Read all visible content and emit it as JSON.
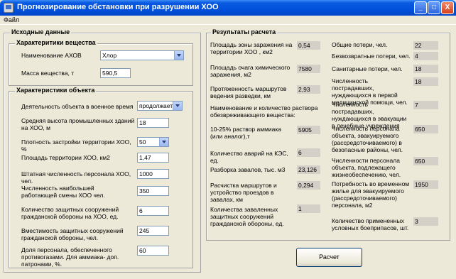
{
  "window": {
    "title": "Прогнозирование обстановки при разрушении ХОО",
    "minimize_glyph": "_",
    "maximize_glyph": "□",
    "close_glyph": "X"
  },
  "menu": {
    "file": "Файл"
  },
  "input_panel": {
    "title": "Исходные данные",
    "substance": {
      "title": "Характеритики вещества",
      "ahov_label": "Наименование АХОВ",
      "ahov_value": "Хлор",
      "mass_label": "Масса вещества, т",
      "mass_value": "590,5"
    },
    "object": {
      "title": "Характеристики объекта",
      "wartime_label": "Деятельность объекта в военное время",
      "wartime_value": "продолжает",
      "height_label": "Средняя высота промышленных зданий на ХОО, м",
      "height_value": "18",
      "density_label": "Плотность застройки территории ХОО, %",
      "density_value": "50",
      "area_label": "Площадь территории ХОО, км2",
      "area_value": "1,47",
      "staff_label": "Штатная численность персонала ХОО, чел.",
      "staff_value": "1000",
      "shift_label": "Численность наибольшей работающей смены ХОО чел.",
      "shift_value": "350",
      "shelters_label": "Количество защитных сооружений гражданской обороны на ХОО, ед.",
      "shelters_value": "6",
      "capacity_label": "Вместимость защитных сооружений гражданской обороны, чел.",
      "capacity_value": "245",
      "masks_label": "Доля персонала, обеспеченного противогазами. Для аммиака- доп. патронами, %.",
      "masks_value": "60"
    }
  },
  "results_panel": {
    "title": "Результаты расчета",
    "left": [
      {
        "label": "Площадь зоны заражения на территории ХОО , км2",
        "value": "0,54"
      },
      {
        "label": "Площадь очага химического заражения, м2",
        "value": "7580"
      },
      {
        "label": "Протяженность маршрутов ведения разведки, км",
        "value": "2,93"
      },
      {
        "label": "Наименование и количество раствора обезвреживающего вещества:",
        "value": ""
      },
      {
        "label": "10-25% раствор аммиака (или аналог),т",
        "value": "5905"
      },
      {
        "label": "Количество аварий на КЭС, ед.",
        "value": "6"
      },
      {
        "label": "Разборка завалов, тыс. м3",
        "value": "23,126"
      },
      {
        "label": "Расчистка маршрутов и устройство проездов в завалах, км",
        "value": "0,294"
      },
      {
        "label": "Количества заваленных защитных сооружений гражданской обороны, ед.",
        "value": "1"
      }
    ],
    "right": [
      {
        "label": "Общие потери, чел.",
        "value": "22"
      },
      {
        "label": "Безвозвратные потери, чел.",
        "value": "4"
      },
      {
        "label": "Санитарные потери, чел.",
        "value": "18"
      },
      {
        "label": "Численность пострадавших, нуждающихся в первой медицинской помощи, чел.",
        "value": "18"
      },
      {
        "label": "Численность пострадавших, нуждающихся в эвакуации в лечебные учреждения",
        "value": "7"
      },
      {
        "label": "Численность персонала объекта, эвакуируемого (рассредоточиваемого) в безопасные районы, чел.",
        "value": "650"
      },
      {
        "label": "Численности персонала объекта, подлежащего жизнеобеспечению, чел.",
        "value": "650"
      },
      {
        "label": "Потребность во временном жилье для эвакуируемого (рассредоточиваемого) персонала, м2",
        "value": "1950"
      },
      {
        "label": "Количество примененных условных боеприпасов, шт.",
        "value": "3"
      }
    ]
  },
  "buttons": {
    "calculate": "Расчет"
  }
}
